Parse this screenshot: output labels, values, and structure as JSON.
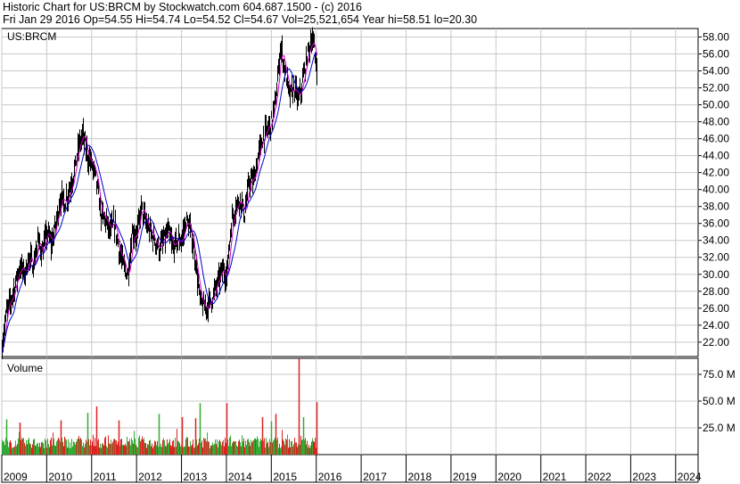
{
  "header": {
    "line1": "Historic Chart for US:BRCM by Stockwatch.com 604.687.1500 - (c) 2016",
    "line2": "Fri Jan 29 2016   Op=54.55   Hi=54.74   Lo=54.52   Cl=54.67   Vol=25,521,654   Year hi=58.51   lo=20.30"
  },
  "price_panel": {
    "label": "US:BRCM"
  },
  "volume_panel": {
    "label": "Volume"
  },
  "colors": {
    "price_bars": "#000000",
    "ma_short": "#cc00cc",
    "ma_long": "#0000cc",
    "vol_up": "#33aa33",
    "vol_down": "#dd2222",
    "grid": "#c8c8c8"
  },
  "chart_data": [
    {
      "type": "line",
      "title": "US:BRCM",
      "grid": true,
      "y_axis_side": "right",
      "ylim": [
        20.3,
        59
      ],
      "y_ticks": [
        "58.00",
        "56.00",
        "54.00",
        "52.00",
        "50.00",
        "48.00",
        "46.00",
        "44.00",
        "42.00",
        "40.00",
        "38.00",
        "36.00",
        "34.00",
        "32.00",
        "30.00",
        "28.00",
        "26.00",
        "24.00",
        "22.00"
      ],
      "x_ticks": [
        "2009",
        "2010",
        "2011",
        "2012",
        "2013",
        "2014",
        "2015",
        "2016",
        "2017",
        "2018",
        "2019",
        "2020",
        "2021",
        "2022",
        "2023",
        "2024"
      ],
      "xlim": [
        2009.0,
        2024.5
      ],
      "series": [
        {
          "x": [
            2009.0,
            2009.1,
            2009.2,
            2009.3,
            2009.4,
            2009.5,
            2009.6,
            2009.7,
            2009.8,
            2009.9,
            2010.0,
            2010.1,
            2010.2,
            2010.3,
            2010.4,
            2010.5,
            2010.6,
            2010.7,
            2010.8,
            2010.9,
            2011.0,
            2011.1,
            2011.2,
            2011.3,
            2011.4,
            2011.5,
            2011.6,
            2011.7,
            2011.8,
            2011.9,
            2012.0,
            2012.1,
            2012.2,
            2012.3,
            2012.4,
            2012.5,
            2012.6,
            2012.7,
            2012.8,
            2012.9,
            2013.0,
            2013.1,
            2013.2,
            2013.3,
            2013.4,
            2013.5,
            2013.6,
            2013.7,
            2013.8,
            2013.9,
            2014.0,
            2014.1,
            2014.2,
            2014.3,
            2014.4,
            2014.5,
            2014.6,
            2014.7,
            2014.8,
            2014.9,
            2015.0,
            2015.1,
            2015.2,
            2015.3,
            2015.4,
            2015.5,
            2015.6,
            2015.7,
            2015.8,
            2015.9,
            2016.0
          ],
          "values": [
            21.5,
            25.5,
            27,
            29,
            31,
            30,
            32,
            31,
            34,
            32.5,
            35,
            33.5,
            36,
            39,
            38.5,
            40,
            42,
            45,
            46.5,
            44,
            43,
            41,
            37,
            36.5,
            35,
            36,
            33,
            31,
            30,
            35,
            34.5,
            38,
            36,
            35,
            34,
            33,
            34,
            35,
            33,
            34,
            34,
            36.5,
            35,
            32,
            27,
            26,
            26.5,
            27.5,
            29,
            30.5,
            30,
            36,
            38,
            39,
            37,
            41,
            41,
            44,
            46,
            47,
            48,
            51,
            57,
            54,
            51,
            52,
            50.5,
            53,
            56,
            58,
            54.67
          ]
        }
      ]
    },
    {
      "type": "bar",
      "title": "Volume",
      "grid": true,
      "y_axis_side": "right",
      "ylim": [
        0,
        90
      ],
      "y_ticks": [
        "75.0 M",
        "50.0 M",
        "25.0 M"
      ],
      "ylabel": "",
      "series": [
        {
          "x": [
            2009.1,
            2009.4,
            2010.3,
            2010.9,
            2011.1,
            2011.6,
            2012.5,
            2013.0,
            2013.3,
            2013.4,
            2014.0,
            2014.8,
            2015.0,
            2015.1,
            2015.6,
            2015.7,
            2016.0
          ],
          "values": [
            33,
            30,
            32,
            39,
            45,
            32,
            38,
            35,
            34,
            48,
            48,
            35,
            31,
            38,
            90,
            35,
            49
          ]
        }
      ]
    }
  ]
}
